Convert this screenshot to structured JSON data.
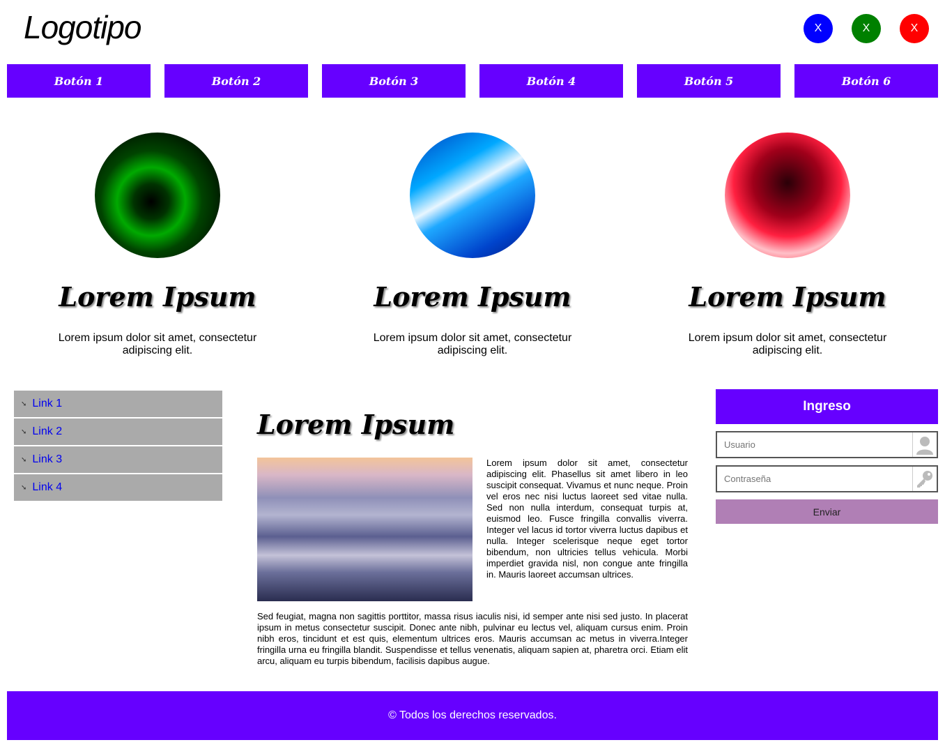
{
  "header": {
    "logo": "Logotipo",
    "buttons": [
      "X",
      "X",
      "X"
    ]
  },
  "nav": {
    "items": [
      "Botón 1",
      "Botón 2",
      "Botón 3",
      "Botón 4",
      "Botón 5",
      "Botón 6"
    ]
  },
  "features": [
    {
      "title": "Lorem Ipsum",
      "text": "Lorem ipsum dolor sit amet, consectetur adipiscing elit."
    },
    {
      "title": "Lorem Ipsum",
      "text": "Lorem ipsum dolor sit amet, consectetur adipiscing elit."
    },
    {
      "title": "Lorem Ipsum",
      "text": "Lorem ipsum dolor sit amet, consectetur adipiscing elit."
    }
  ],
  "sidebar": {
    "links": [
      "Link 1",
      "Link 2",
      "Link 3",
      "Link 4"
    ]
  },
  "article": {
    "title": "Lorem Ipsum",
    "p1": "Lorem ipsum dolor sit amet, consectetur adipiscing elit. Phasellus sit amet libero in leo suscipit consequat. Vivamus et nunc neque. Proin vel eros nec nisi luctus laoreet sed vitae nulla. Sed non nulla interdum, consequat turpis at, euismod leo. Fusce fringilla convallis viverra. Integer vel lacus id tortor viverra luctus dapibus et nulla. Integer scelerisque neque eget tortor bibendum, non ultricies tellus vehicula. Morbi imperdiet gravida nisl, non congue ante fringilla in. Mauris laoreet accumsan ultrices.",
    "p2": "Sed feugiat, magna non sagittis porttitor, massa risus iaculis nisi, id semper ante nisi sed justo. In placerat ipsum in metus consectetur suscipit. Donec ante nibh, pulvinar eu lectus vel, aliquam cursus enim. Proin nibh eros, tincidunt et est quis, elementum ultrices eros. Mauris accumsan ac metus in viverra.Integer fringilla urna eu fringilla blandit. Suspendisse et tellus venenatis, aliquam sapien at, pharetra orci. Etiam elit arcu, aliquam eu turpis bibendum, facilisis dapibus augue."
  },
  "login": {
    "title": "Ingreso",
    "user_placeholder": "Usuario",
    "password_placeholder": "Contraseña",
    "submit": "Enviar"
  },
  "footer": {
    "text": "© Todos los derechos reservados."
  },
  "colors": {
    "primary": "#6600ff",
    "sidebar": "#aaaaaa",
    "submit": "#b07fb5",
    "btn_blue": "#0000ff",
    "btn_green": "#008000",
    "btn_red": "#ff0000"
  }
}
